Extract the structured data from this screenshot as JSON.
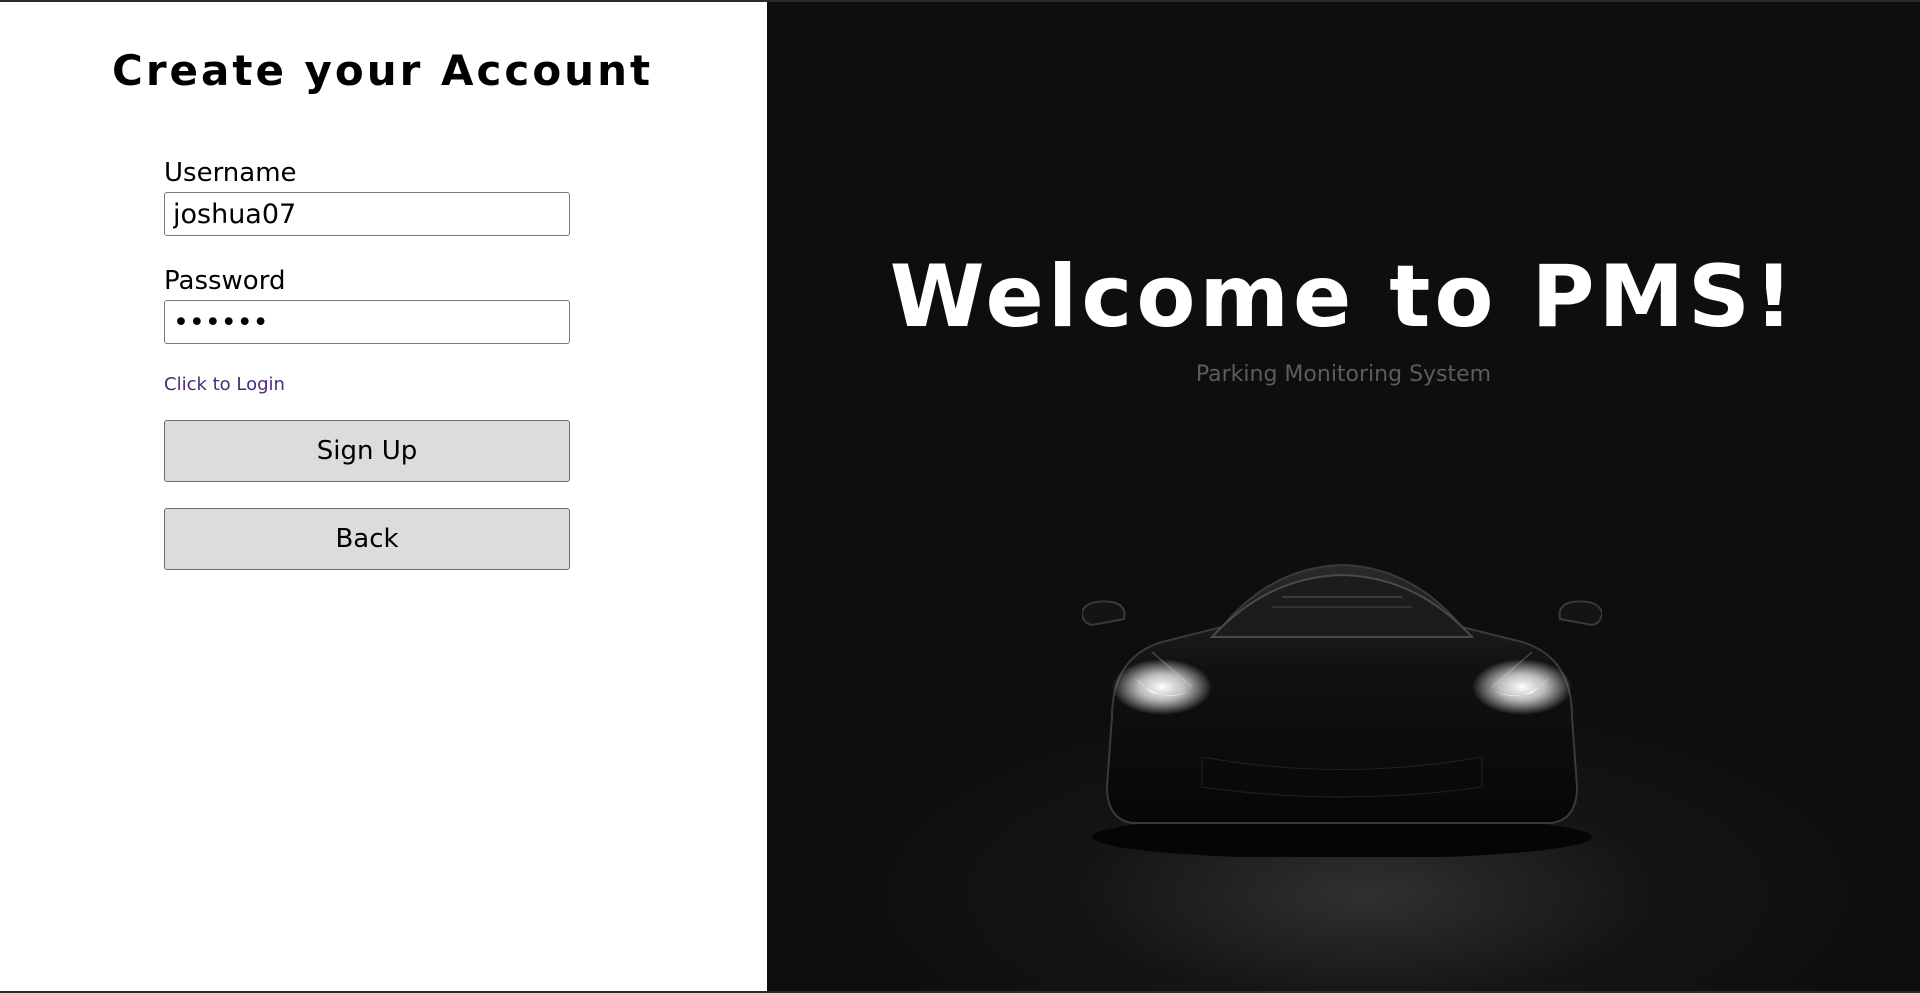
{
  "form": {
    "title": "Create your Account",
    "username_label": "Username",
    "username_value": "joshua07",
    "password_label": "Password",
    "password_value": "••••••",
    "login_link": "Click to Login",
    "signup_button": "Sign Up",
    "back_button": "Back"
  },
  "hero": {
    "title": "Welcome to PMS!",
    "subtitle": "Parking Monitoring System",
    "image": "car-silhouette-icon"
  },
  "colors": {
    "left_background": "#ffffff",
    "right_background": "#0e0e0e",
    "button_background": "#dcdcdf",
    "link": "#4b2a7a",
    "subtitle": "#5c5c5c"
  }
}
